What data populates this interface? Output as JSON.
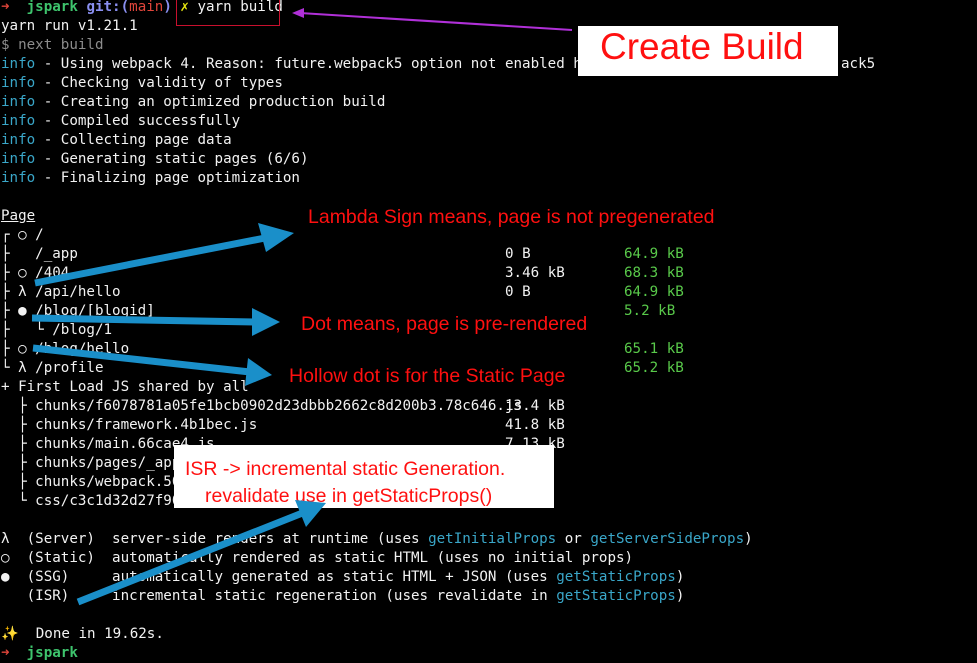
{
  "prompt": {
    "arrow": "➜",
    "user": "jspark",
    "git_prefix": "git:(",
    "branch": "main",
    "git_suffix": ")",
    "dirty": "✗",
    "command": "yarn build"
  },
  "output": {
    "yarn_line": "yarn run v1.21.1",
    "next_line": "$ next build",
    "info_label": "info",
    "info_lines": [
      " - Using webpack 4. Reason: future.webpack5 option not enabled http",
      " - Checking validity of types",
      " - Creating an optimized production build",
      " - Compiled successfully",
      " - Collecting page data",
      " - Generating static pages (6/6)",
      " - Finalizing page optimization"
    ],
    "webpack5_tail": "ack5"
  },
  "table": {
    "header": "Page",
    "routes": [
      {
        "prefix": "┌ ○ /",
        "size": "",
        "first_load": ""
      },
      {
        "prefix": "├   /_app",
        "size": "0 B",
        "first_load": "64.9 kB"
      },
      {
        "prefix": "├ ○ /404",
        "size": "3.46 kB",
        "first_load": "68.3 kB"
      },
      {
        "prefix": "├ λ /api/hello",
        "size": "0 B",
        "first_load": "64.9 kB"
      },
      {
        "prefix": "├ ● /blog/[blogid]",
        "size": "",
        "first_load": "5.2 kB"
      },
      {
        "prefix": "├   └ /blog/1",
        "size": "",
        "first_load": ""
      },
      {
        "prefix": "├ ○ /blog/hello",
        "size": "",
        "first_load": "65.1 kB"
      },
      {
        "prefix": "└ λ /profile",
        "size": "",
        "first_load": "65.2 kB"
      }
    ],
    "shared_header": "+ First Load JS shared by all",
    "chunks": [
      {
        "name": "  ├ chunks/f6078781a05fe1bcb0902d23dbbb2662c8d200b3.78c646.js",
        "size": "13.4 kB"
      },
      {
        "name": "  ├ chunks/framework.4b1bec.js",
        "size": "41.8 kB"
      },
      {
        "name": "  ├ chunks/main.66cae4.js",
        "size": "7.13 kB"
      },
      {
        "name": "  ├ chunks/pages/_app.",
        "size": ""
      },
      {
        "name": "  ├ chunks/webpack.50b",
        "size": ""
      },
      {
        "name": "  └ css/c3c1d32d27f907",
        "size": ""
      }
    ]
  },
  "legend": [
    {
      "symbol": "λ",
      "label": "  (Server)  ",
      "desc": "server-side renders at runtime (uses ",
      "fn1": "getInitialProps",
      "mid": " or ",
      "fn2": "getServerSideProps",
      "end": ")"
    },
    {
      "symbol": "○",
      "label": "  (Static)  ",
      "desc": "automatically rendered as static HTML (uses no initial props)",
      "fn1": "",
      "mid": "",
      "fn2": "",
      "end": ""
    },
    {
      "symbol": "●",
      "label": "  (SSG)     ",
      "desc": "automatically generated as static HTML + JSON (uses ",
      "fn1": "getStaticProps",
      "mid": "",
      "fn2": "",
      "end": ")"
    },
    {
      "symbol": " ",
      "label": "  (ISR)     ",
      "desc": "incremental static regeneration (uses revalidate in ",
      "fn1": "getStaticProps",
      "mid": "",
      "fn2": "",
      "end": ")"
    }
  ],
  "done": {
    "icon": "✨",
    "text": "  Done in 19.62s."
  },
  "annotations": {
    "create_build": "Create Build",
    "lambda": "Lambda Sign means, page is not pregenerated",
    "dot": "Dot means, page is pre-rendered",
    "hollow": "Hollow dot is for the Static Page",
    "isr_line1": "ISR -> incremental static Generation.",
    "isr_line2": "revalidate use in getStaticProps()"
  },
  "colors": {
    "annotation_red": "#ff1010",
    "arrow_blue": "#1a8fc9",
    "info_blue": "#3aa7c9",
    "size_green": "#59c94a"
  }
}
